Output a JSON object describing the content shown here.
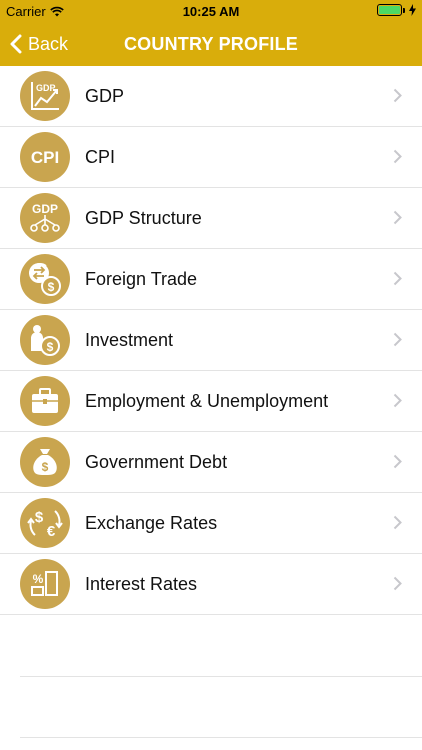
{
  "status_bar": {
    "carrier": "Carrier",
    "time": "10:25 AM"
  },
  "nav": {
    "back_label": "Back",
    "title": "COUNTRY PROFILE"
  },
  "colors": {
    "bar": "#d9ad0b",
    "icon_bg": "#c9a54f",
    "separator": "#e3e3e3"
  },
  "items": [
    {
      "label": "GDP",
      "icon": "gdp-chart-icon",
      "icon_text": "GDP"
    },
    {
      "label": "CPI",
      "icon": "cpi-icon",
      "icon_text": "CPI"
    },
    {
      "label": "GDP Structure",
      "icon": "gdp-structure-icon",
      "icon_text": "GDP"
    },
    {
      "label": "Foreign Trade",
      "icon": "foreign-trade-icon"
    },
    {
      "label": "Investment",
      "icon": "investment-icon"
    },
    {
      "label": "Employment & Unemployment",
      "icon": "briefcase-icon"
    },
    {
      "label": "Government Debt",
      "icon": "money-bag-icon"
    },
    {
      "label": "Exchange Rates",
      "icon": "exchange-rates-icon"
    },
    {
      "label": "Interest Rates",
      "icon": "interest-rates-icon",
      "icon_text": "%"
    }
  ]
}
